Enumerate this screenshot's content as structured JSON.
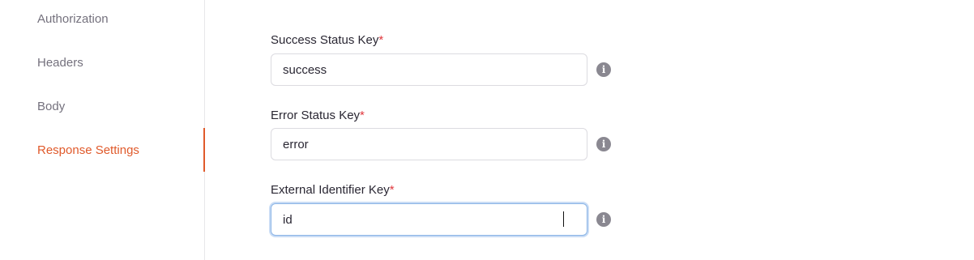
{
  "sidebar": {
    "items": [
      {
        "label": "Authorization",
        "active": false
      },
      {
        "label": "Headers",
        "active": false
      },
      {
        "label": "Body",
        "active": false
      },
      {
        "label": "Response Settings",
        "active": true
      }
    ]
  },
  "form": {
    "fields": [
      {
        "label": "Success Status Key",
        "required_mark": "*",
        "value": "success",
        "info_glyph": "i"
      },
      {
        "label": "Error Status Key",
        "required_mark": "*",
        "value": "error",
        "info_glyph": "i"
      },
      {
        "label": "External Identifier Key",
        "required_mark": "*",
        "value": "id",
        "info_glyph": "i"
      }
    ]
  },
  "colors": {
    "accent": "#e05a2b",
    "required": "#e0393e",
    "focus_border": "#8ab4e6"
  }
}
